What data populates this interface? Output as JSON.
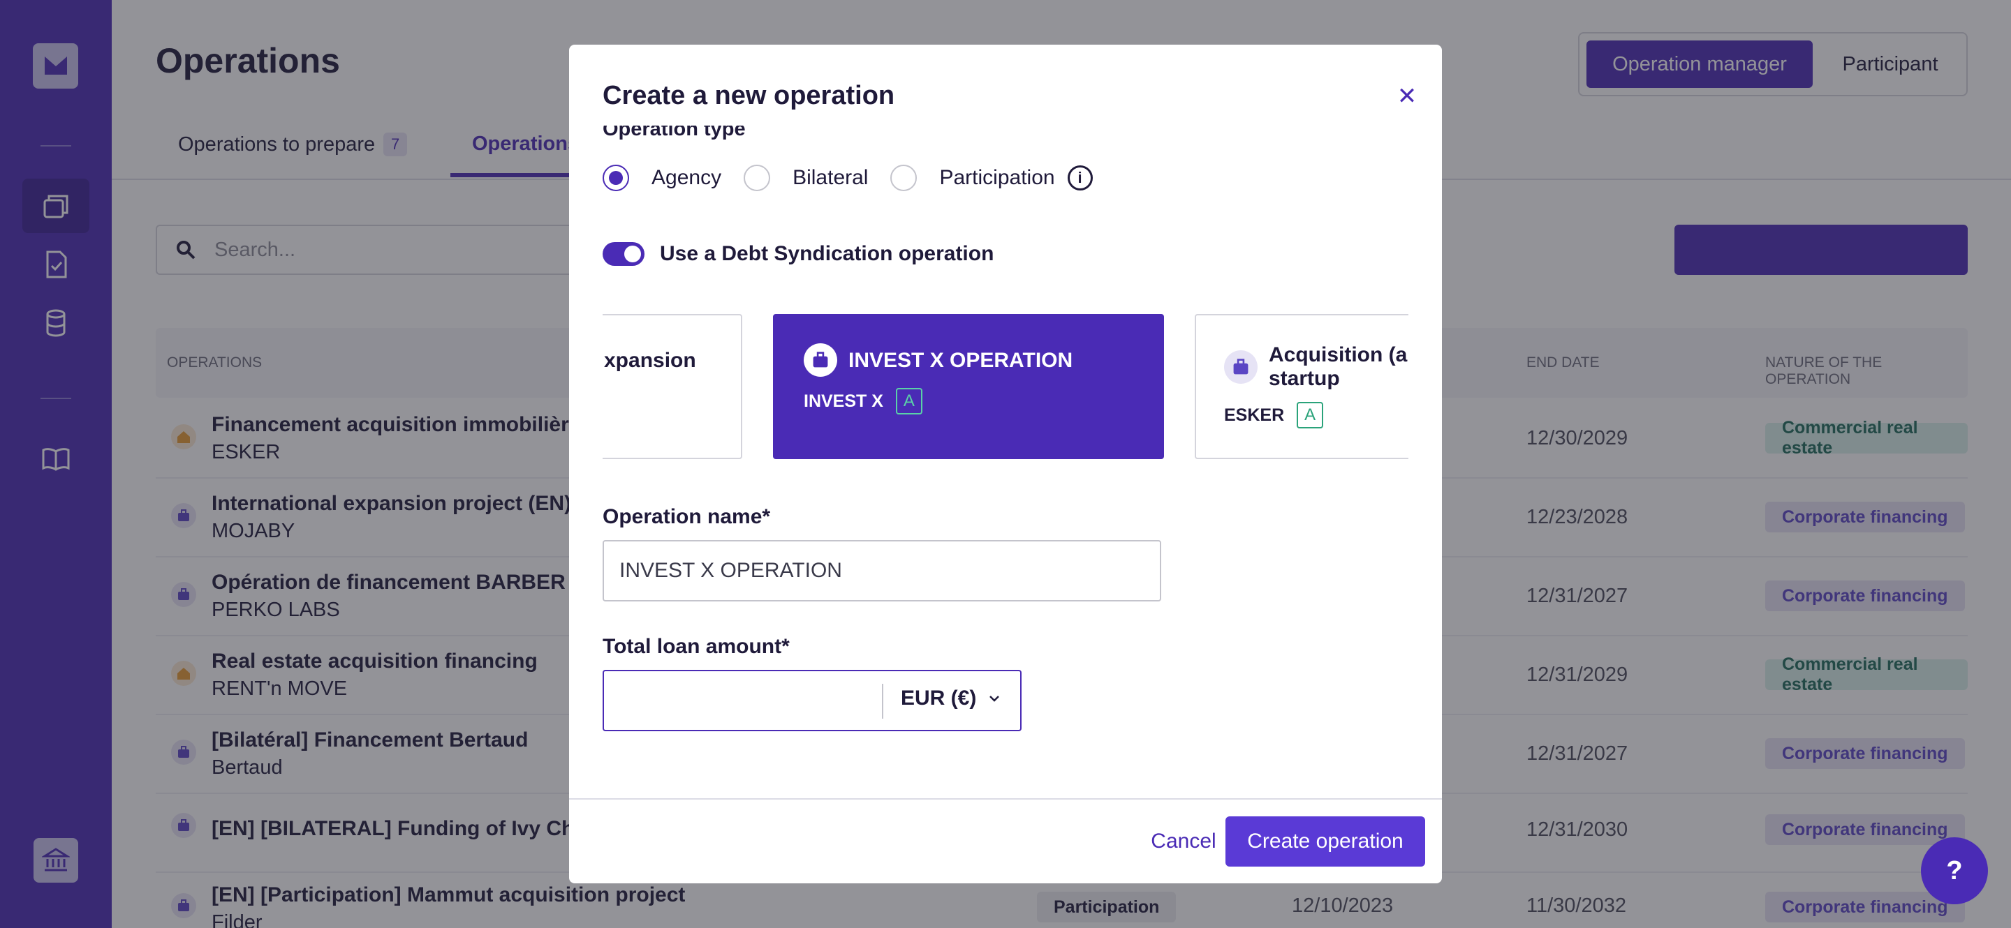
{
  "page": {
    "title": "Operations"
  },
  "mode_switch": {
    "selected": "Operation manager",
    "other": "Participant"
  },
  "tabs": [
    {
      "label": "Operations to prepare",
      "count": "7"
    },
    {
      "label": "Operations"
    }
  ],
  "search": {
    "placeholder": "Search..."
  },
  "table": {
    "headers": {
      "operations": "OPERATIONS",
      "end_date": "END DATE",
      "nature": "NATURE OF THE OPERATION"
    },
    "rows": [
      {
        "name": "Financement acquisition immobilière",
        "company": "ESKER",
        "icon": "house-icon",
        "type": "",
        "start": "",
        "end": "12/30/2029",
        "nature": "Commercial real estate"
      },
      {
        "name": "International expansion project (EN)",
        "company": "MOJABY",
        "icon": "briefcase-icon",
        "type": "",
        "start": "",
        "end": "12/23/2028",
        "nature": "Corporate financing"
      },
      {
        "name": "Opération de financement BARBER",
        "company": "PERKO LABS",
        "icon": "briefcase-icon",
        "type": "",
        "start": "",
        "end": "12/31/2027",
        "nature": "Corporate financing"
      },
      {
        "name": "Real estate acquisition financing",
        "company": "RENT'n MOVE",
        "icon": "house-icon",
        "type": "",
        "start": "",
        "end": "12/31/2029",
        "nature": "Commercial real estate"
      },
      {
        "name": "[Bilatéral] Financement Bertaud",
        "company": "Bertaud",
        "icon": "briefcase-icon",
        "type": "",
        "start": "",
        "end": "12/31/2027",
        "nature": "Corporate financing"
      },
      {
        "name": "[EN] [BILATERAL] Funding of Ivy Che",
        "company": "",
        "icon": "briefcase-icon",
        "type": "",
        "start": "",
        "end": "12/31/2030",
        "nature": "Corporate financing"
      },
      {
        "name": "[EN] [Participation] Mammut acquisition project",
        "company": "Filder",
        "icon": "briefcase-icon",
        "type": "Participation",
        "start": "12/10/2023",
        "end": "11/30/2032",
        "nature": "Corporate financing"
      }
    ]
  },
  "modal": {
    "title": "Create a new operation",
    "operation_type_label": "Operation type",
    "operation_types": [
      {
        "label": "Agency",
        "checked": true
      },
      {
        "label": "Bilateral",
        "checked": false
      },
      {
        "label": "Participation",
        "checked": false
      }
    ],
    "toggle_label": "Use a Debt Syndication operation",
    "toggle_on": true,
    "cards": [
      {
        "name": "xpansion",
        "company": "",
        "grade": "",
        "selected": false
      },
      {
        "name": "INVEST X OPERATION",
        "company": "INVEST X",
        "grade": "A",
        "selected": true
      },
      {
        "name_line1": "Acquisition (a",
        "name_line2": "startup",
        "company": "ESKER",
        "grade": "A",
        "selected": false
      }
    ],
    "operation_name_label": "Operation name",
    "operation_name_value": "INVEST X OPERATION",
    "loan_amount_label": "Total loan amount",
    "loan_amount_value": "",
    "currency": "EUR (€)",
    "cancel_label": "Cancel",
    "submit_label": "Create operation",
    "required_mark": "*"
  },
  "help": {
    "label": "?"
  },
  "colors": {
    "brand": "#4a2bb5",
    "cre_bg": "#d9f0ea",
    "corp_bg": "#e6e3f5"
  }
}
